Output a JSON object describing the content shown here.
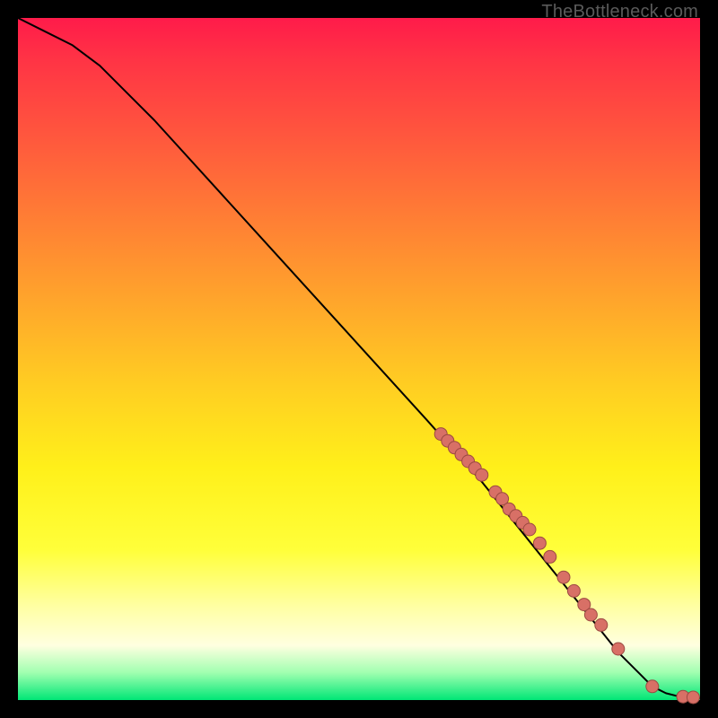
{
  "attribution": "TheBottleneck.com",
  "colors": {
    "background": "#000000",
    "marker_fill": "#d87066",
    "marker_stroke": "#9c4a42",
    "curve": "#000000"
  },
  "chart_data": {
    "type": "line",
    "title": "",
    "xlabel": "",
    "ylabel": "",
    "xlim": [
      0,
      100
    ],
    "ylim": [
      0,
      100
    ],
    "grid": false,
    "legend": false,
    "curve": {
      "name": "bottleneck-curve",
      "x": [
        0,
        4,
        8,
        12,
        20,
        30,
        40,
        50,
        60,
        68,
        72,
        76,
        80,
        84,
        88,
        91,
        93,
        95,
        97,
        99,
        100
      ],
      "y": [
        100,
        98,
        96,
        93,
        85,
        74,
        63,
        52,
        41,
        32,
        27,
        22,
        17,
        12,
        7,
        4,
        2,
        1,
        0.5,
        0.3,
        0.3
      ]
    },
    "series": [
      {
        "name": "highlighted-points",
        "type": "scatter",
        "x": [
          62,
          63,
          64,
          65,
          66,
          67,
          68,
          70,
          71,
          72,
          73,
          74,
          75,
          76.5,
          78,
          80,
          81.5,
          83,
          84,
          85.5,
          88,
          93,
          97.5,
          99
        ],
        "y": [
          39,
          38,
          37,
          36,
          35,
          34,
          33,
          30.5,
          29.5,
          28,
          27,
          26,
          25,
          23,
          21,
          18,
          16,
          14,
          12.5,
          11,
          7.5,
          2,
          0.5,
          0.4
        ]
      }
    ]
  }
}
